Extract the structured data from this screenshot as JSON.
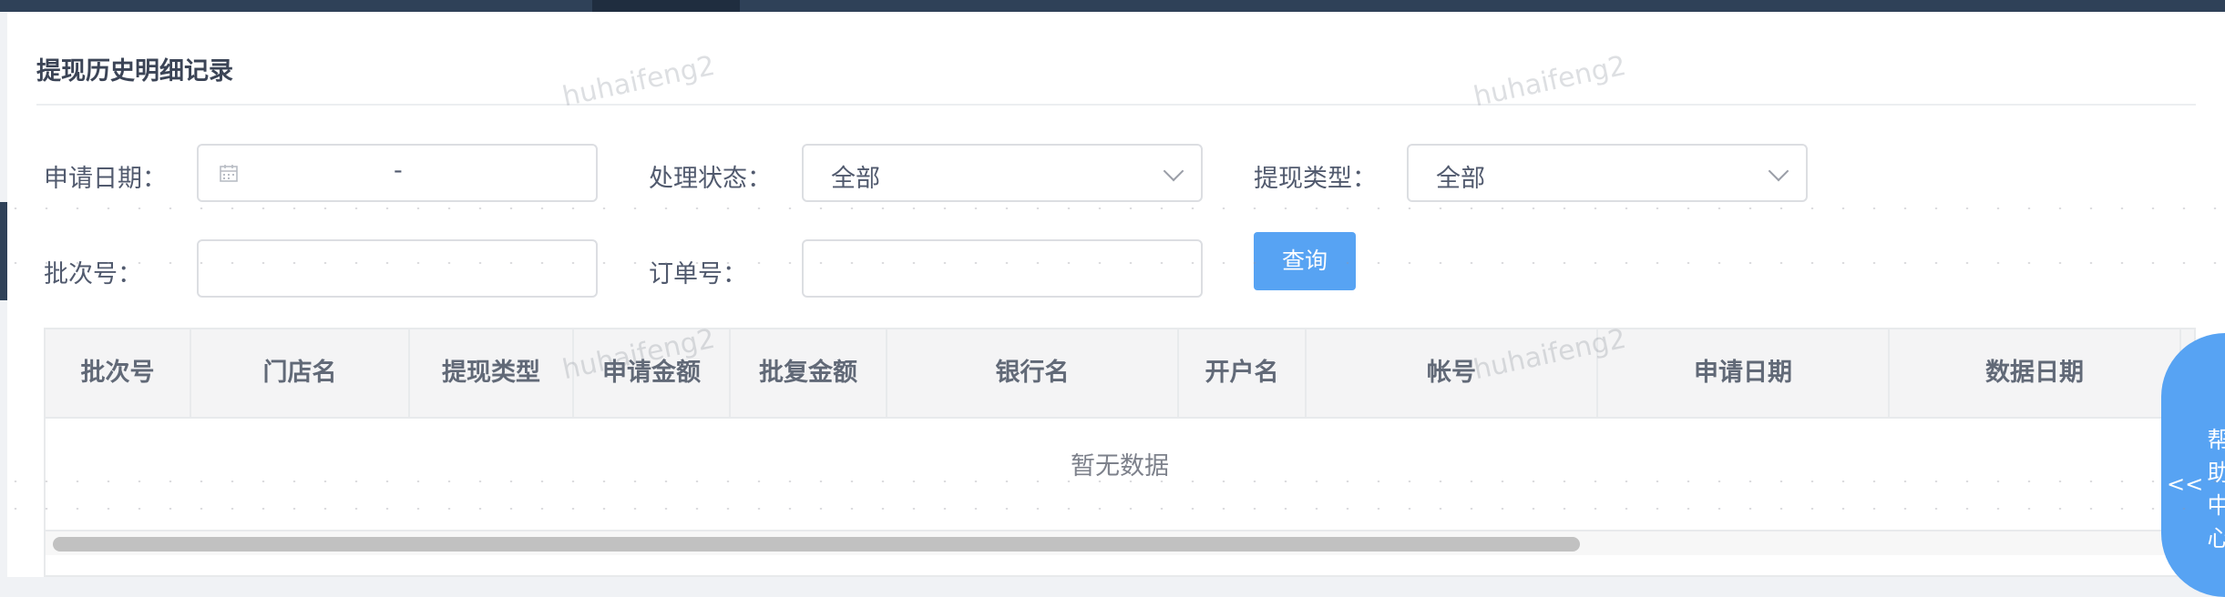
{
  "page": {
    "title": "提现历史明细记录"
  },
  "filters": {
    "apply_date": {
      "label": "申请日期：",
      "separator": "-"
    },
    "process_status": {
      "label": "处理状态：",
      "value": "全部"
    },
    "withdraw_type": {
      "label": "提现类型：",
      "value": "全部"
    },
    "batch_no": {
      "label": "批次号：",
      "value": ""
    },
    "order_no": {
      "label": "订单号：",
      "value": ""
    },
    "query_button": "查询"
  },
  "table": {
    "columns": [
      "批次号",
      "门店名",
      "提现类型",
      "申请金额",
      "批复金额",
      "银行名",
      "开户名",
      "帐号",
      "申请日期",
      "数据日期"
    ],
    "empty_text": "暂无数据",
    "rows": []
  },
  "help": {
    "arrows": "<<",
    "label": "帮助中心"
  },
  "watermark": "huhaifeng2",
  "colors": {
    "topbar": "#2f4158",
    "primary": "#57a3f3",
    "border": "#dcdee2",
    "header_bg": "#f4f4f5"
  }
}
